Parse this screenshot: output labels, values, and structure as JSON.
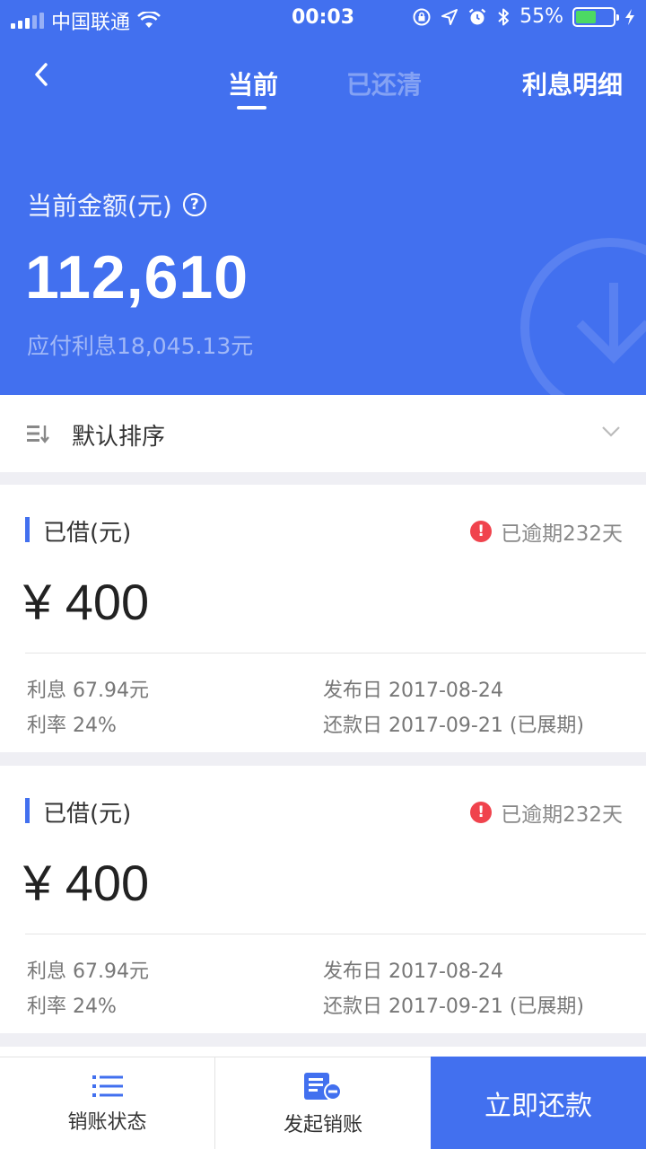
{
  "status_bar": {
    "carrier": "中国联通",
    "time": "00:03",
    "battery_percent": "55%",
    "battery_level": 0.55,
    "icons": [
      "signal-icon",
      "wifi-icon",
      "rotation-lock-icon",
      "location-icon",
      "alarm-icon",
      "bluetooth-icon",
      "battery-icon",
      "charging-icon"
    ]
  },
  "nav": {
    "back_icon": "back-arrow-icon",
    "tabs": [
      {
        "label": "当前",
        "active": true
      },
      {
        "label": "已还清",
        "active": false
      }
    ],
    "right_link": "利息明细"
  },
  "summary": {
    "label": "当前金额(元)",
    "help_icon": "?",
    "amount": "112,610",
    "interest_due": "应付利息18,045.13元"
  },
  "sort": {
    "icon": "sort-icon",
    "label": "默认排序",
    "chevron_icon": "chevron-down-icon"
  },
  "loans": [
    {
      "label": "已借(元)",
      "warn_glyph": "!",
      "overdue": "已逾期232天",
      "amount": "¥ 400",
      "interest": "利息 67.94元",
      "rate": "利率 24%",
      "publish_date": "发布日 2017-08-24",
      "due_date": "还款日 2017-09-21 (已展期)"
    },
    {
      "label": "已借(元)",
      "warn_glyph": "!",
      "overdue": "已逾期232天",
      "amount": "¥ 400",
      "interest": "利息 67.94元",
      "rate": "利率 24%",
      "publish_date": "发布日 2017-08-24",
      "due_date": "还款日 2017-09-21 (已展期)"
    }
  ],
  "bottom_bar": {
    "status_label": "销账状态",
    "initiate_label": "发起销账",
    "repay_label": "立即还款"
  },
  "colors": {
    "primary": "#4270ef",
    "warning": "#f0434d",
    "battery": "#4cd964"
  }
}
